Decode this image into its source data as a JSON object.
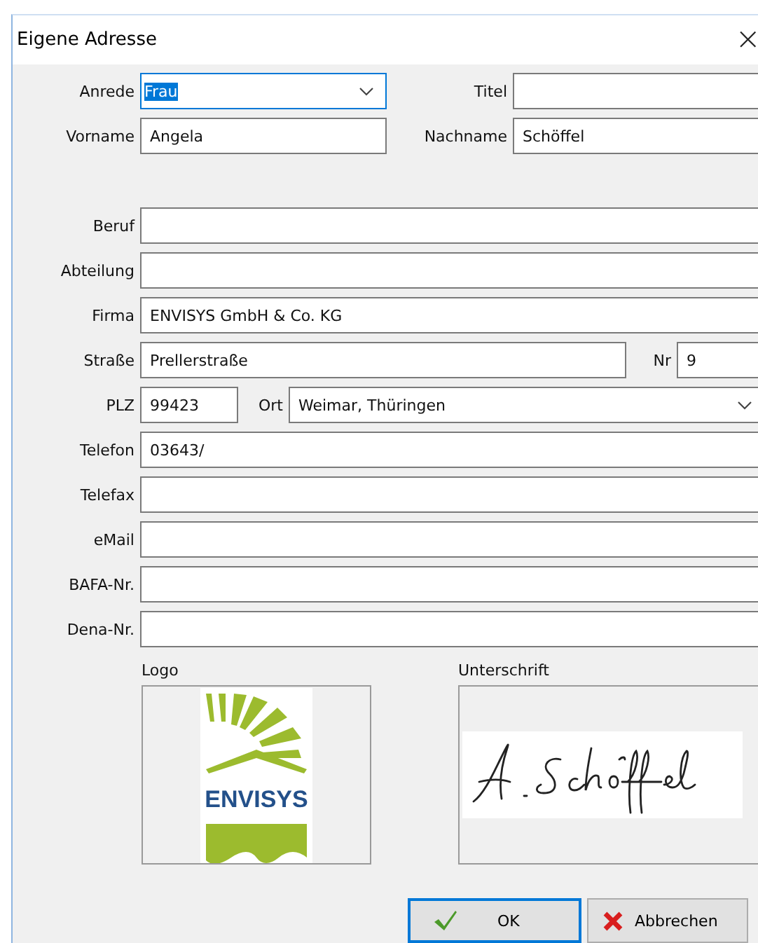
{
  "window": {
    "title": "Eigene Adresse",
    "close": "×"
  },
  "sections": [
    {
      "rows": [
        {
          "kind": "pair",
          "fields": [
            {
              "label": "Anrede",
              "value": "Frau",
              "kind": "combo",
              "focused": true
            },
            {
              "label": "Titel",
              "kind": "text",
              "focused": false
            }
          ]
        },
        {
          "kind": "pair",
          "fields": [
            {
              "label": "Vorname",
              "value": "Angela",
              "kind": "text",
              "focused": false
            },
            {
              "label": "Nachname",
              "value": "Schöffel",
              "kind": "text",
              "focused": false
            }
          ]
        }
      ]
    },
    {
      "rows": [
        {
          "kind": "full",
          "fields": [
            {
              "label": "Beruf",
              "kind": "text",
              "focused": false
            }
          ]
        },
        {
          "kind": "full",
          "fields": [
            {
              "label": "Abteilung",
              "kind": "text",
              "focused": false
            }
          ]
        },
        {
          "kind": "full",
          "fields": [
            {
              "label": "Firma",
              "value": "ENVISYS GmbH & Co. KG",
              "kind": "text",
              "focused": false
            }
          ]
        },
        {
          "kind": "street",
          "fields": [
            {
              "label": "Straße",
              "value": "Prellerstraße",
              "kind": "text",
              "focused": false
            },
            {
              "label": "Nr",
              "value": "9",
              "kind": "text",
              "focused": false
            }
          ]
        },
        {
          "kind": "city",
          "fields": [
            {
              "label": "PLZ",
              "value": "99423",
              "kind": "text",
              "focused": false
            },
            {
              "label": "Ort",
              "value": "Weimar, Thüringen",
              "kind": "combo",
              "focused": false
            }
          ]
        },
        {
          "kind": "full",
          "fields": [
            {
              "label": "Telefon",
              "value": "03643/",
              "kind": "text",
              "focused": false
            }
          ]
        },
        {
          "kind": "full",
          "fields": [
            {
              "label": "Telefax",
              "kind": "text",
              "focused": false
            }
          ]
        },
        {
          "kind": "full",
          "fields": [
            {
              "label": "eMail",
              "kind": "text",
              "focused": false
            }
          ]
        },
        {
          "kind": "full",
          "fields": [
            {
              "label": "BAFA-Nr.",
              "kind": "text",
              "focused": false
            }
          ]
        },
        {
          "kind": "full",
          "fields": [
            {
              "label": "Dena-Nr.",
              "kind": "text",
              "focused": false
            }
          ]
        }
      ]
    }
  ],
  "images": {
    "logo": {
      "label": "Logo",
      "text": "ENVISYS"
    },
    "signature": {
      "label": "Unterschrift"
    }
  },
  "buttons": [
    {
      "label": "OK",
      "kind": "ok",
      "default": true
    },
    {
      "label": "Abbrechen",
      "kind": "cancel",
      "default": false
    }
  ]
}
